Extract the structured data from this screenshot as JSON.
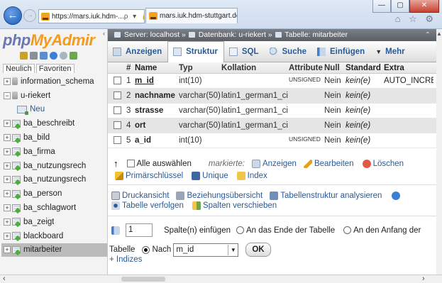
{
  "browser": {
    "address": "https://mars.iuk.hdm-...",
    "address_tools": "ρ ▾ 🔒 C",
    "tab_title": "mars.iuk.hdm-stuttgart.de ...",
    "tab_close": "×",
    "min_btn": "—",
    "max_btn": "▢",
    "close_btn": "✕",
    "right_icons": "⌂ ☆ ⚙"
  },
  "nav": {
    "logo_php": "php",
    "logo_my": "My",
    "logo_admin": "Admir",
    "tabs": [
      "Neulich",
      "Favoriten"
    ],
    "tree": [
      {
        "label": "information_schema",
        "kind": "db",
        "expander": "+"
      },
      {
        "label": "u-riekert",
        "kind": "db",
        "expander": "−"
      },
      {
        "label": "Neu",
        "kind": "new"
      },
      {
        "label": "ba_beschreibt",
        "kind": "table",
        "expander": "+"
      },
      {
        "label": "ba_bild",
        "kind": "table",
        "expander": "+"
      },
      {
        "label": "ba_firma",
        "kind": "table",
        "expander": "+"
      },
      {
        "label": "ba_nutzungsrech",
        "kind": "table",
        "expander": "+"
      },
      {
        "label": "ba_nutzungsrech",
        "kind": "table",
        "expander": "+"
      },
      {
        "label": "ba_person",
        "kind": "table",
        "expander": "+"
      },
      {
        "label": "ba_schlagwort",
        "kind": "table",
        "expander": "+"
      },
      {
        "label": "ba_zeigt",
        "kind": "table",
        "expander": "+"
      },
      {
        "label": "blackboard",
        "kind": "table",
        "expander": "+"
      },
      {
        "label": "mitarbeiter",
        "kind": "table",
        "expander": "+",
        "selected": true
      }
    ]
  },
  "breadcrumb": {
    "server": "Server: localhost",
    "sep1": "»",
    "db": "Datenbank: u-riekert",
    "sep2": "»",
    "table": "Tabelle: mitarbeiter"
  },
  "topmenu": [
    {
      "label": "Anzeigen",
      "icon": "browse-icon"
    },
    {
      "label": "Struktur",
      "icon": "structure-icon",
      "active": true
    },
    {
      "label": "SQL",
      "icon": "sql-icon"
    },
    {
      "label": "Suche",
      "icon": "search-icon"
    },
    {
      "label": "Einfügen",
      "icon": "insert-icon"
    },
    {
      "label": "Mehr",
      "icon": "more-icon",
      "prefix": "▼"
    }
  ],
  "columns_header": {
    "num": "#",
    "name": "Name",
    "type": "Typ",
    "collation": "Kollation",
    "attribute": "Attribute",
    "null": "Null",
    "default": "Standard",
    "extra": "Extra"
  },
  "columns": [
    {
      "num": "1",
      "name": "m_id",
      "type": "int(10)",
      "collation": "",
      "attribute": "UNSIGNED",
      "null": "Nein",
      "default": "kein(e)",
      "extra": "AUTO_INCREMENT",
      "pk": true
    },
    {
      "num": "2",
      "name": "nachname",
      "type": "varchar(50)",
      "collation": "latin1_german1_ci",
      "attribute": "",
      "null": "Nein",
      "default": "kein(e)",
      "extra": "",
      "pk": false
    },
    {
      "num": "3",
      "name": "strasse",
      "type": "varchar(50)",
      "collation": "latin1_german1_ci",
      "attribute": "",
      "null": "Nein",
      "default": "kein(e)",
      "extra": "",
      "pk": false
    },
    {
      "num": "4",
      "name": "ort",
      "type": "varchar(50)",
      "collation": "latin1_german1_ci",
      "attribute": "",
      "null": "Nein",
      "default": "kein(e)",
      "extra": "",
      "pk": false
    },
    {
      "num": "5",
      "name": "a_id",
      "type": "int(10)",
      "collation": "",
      "attribute": "UNSIGNED",
      "null": "Nein",
      "default": "kein(e)",
      "extra": "",
      "pk": false
    }
  ],
  "actions": {
    "select_all": "Alle auswählen",
    "marked": "markierte:",
    "browse": "Anzeigen",
    "edit": "Bearbeiten",
    "delete": "Löschen",
    "primary": "Primärschlüssel",
    "unique": "Unique",
    "index": "Index"
  },
  "links": {
    "print": "Druckansicht",
    "relations": "Beziehungsübersicht",
    "analyze": "Tabellenstruktur analysieren",
    "track": "Tabelle verfolgen",
    "move": "Spalten verschieben"
  },
  "add_columns": {
    "count": "1",
    "label": "Spalte(n) einfügen",
    "end": "An das Ende der Tabelle",
    "start": "An den Anfang der",
    "table_label": "Tabelle",
    "after": "Nach",
    "after_col": "m_id",
    "ok": "OK",
    "indexes": "+ Indizes"
  },
  "colors": {
    "link": "#2a5a96",
    "selected_row": "#bbbbbb",
    "logo_php": "#6c78af",
    "logo_myadmin": "#f29b1f"
  }
}
